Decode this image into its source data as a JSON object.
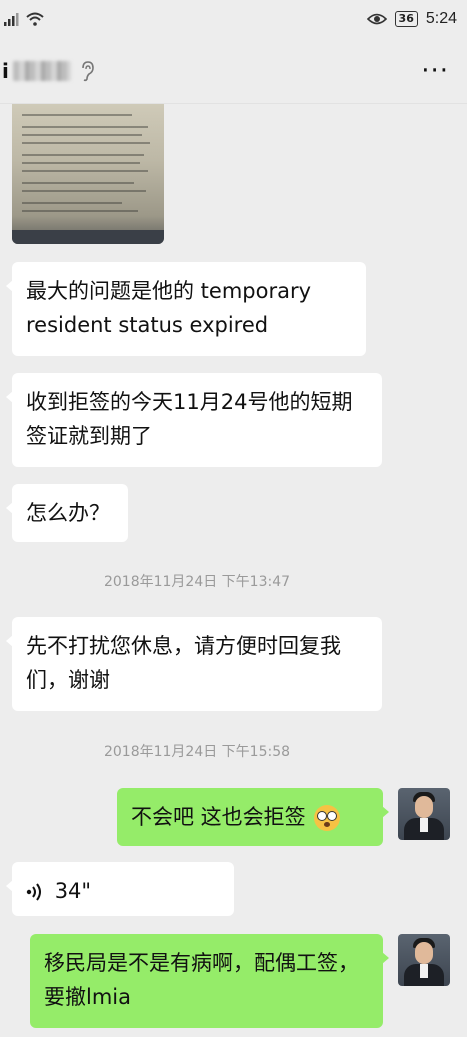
{
  "status_bar": {
    "signal_icon": "signal-icon",
    "wifi_icon": "wifi-icon",
    "eye_icon": "eye-comfort-icon",
    "battery": "36",
    "time": "5:24"
  },
  "header": {
    "contact_name_visible": "i",
    "more_label": "···"
  },
  "messages": [
    {
      "text": "最大的问题是他的 temporary resident status expired"
    },
    {
      "text": "收到拒签的今天11月24号他的短期签证就到期了"
    },
    {
      "text": "怎么办？"
    },
    {
      "text": "先不打扰您休息，请方便时回复我们，谢谢"
    },
    {
      "text": "不会吧 这也会拒签"
    },
    {
      "text": "34\""
    },
    {
      "text": "移民局是不是有病啊，配偶工签，要撤lmia"
    }
  ],
  "timestamps": [
    "2018年11月24日 下午13:47",
    "2018年11月24日 下午15:58"
  ]
}
